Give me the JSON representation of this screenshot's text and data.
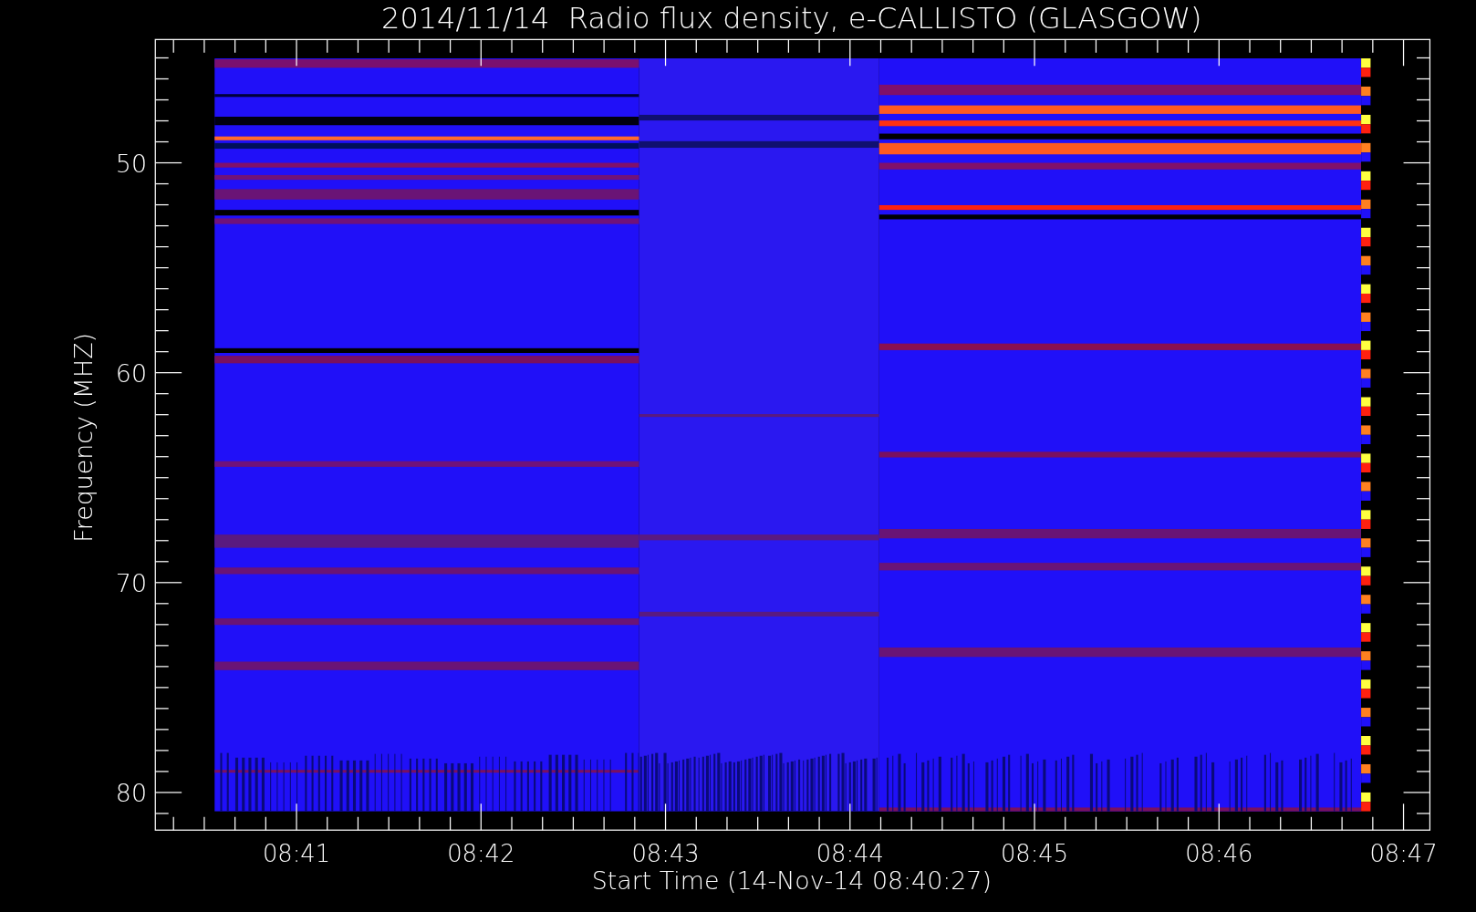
{
  "title": "2014/11/14  Radio flux density, e-CALLISTO (GLASGOW)",
  "y_axis": {
    "label": "Frequency (MHZ)",
    "ticks": [
      "50",
      "60",
      "70",
      "80"
    ]
  },
  "x_axis": {
    "label": "Start Time (14-Nov-14 08:40:27)",
    "ticks": [
      "08:41",
      "08:42",
      "08:43",
      "08:44",
      "08:45",
      "08:46",
      "08:47"
    ]
  }
}
